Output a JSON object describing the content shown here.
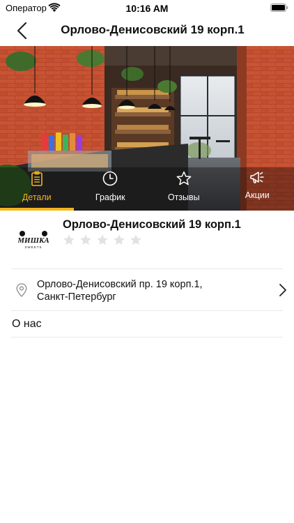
{
  "status_bar": {
    "carrier": "Оператор",
    "time": "10:16 AM"
  },
  "nav": {
    "title": "Орлово-Денисовский 19 корп.1",
    "back_icon": "chevron-left-icon"
  },
  "tabs": [
    {
      "label": "Детали",
      "icon": "clipboard-icon",
      "active": true
    },
    {
      "label": "График",
      "icon": "clock-icon",
      "active": false
    },
    {
      "label": "Отзывы",
      "icon": "star-outline-icon",
      "active": false
    },
    {
      "label": "Акции",
      "icon": "megaphone-icon",
      "active": false
    }
  ],
  "place": {
    "logo_text": "МИШКА",
    "logo_subtext": "SWEETS",
    "title": "Орлово-Денисовский 19 корп.1",
    "rating": 0,
    "rating_max": 5
  },
  "address": {
    "line1": "Орлово-Денисовский пр. 19 корп.1,",
    "line2": "Санкт-Петербург"
  },
  "about": {
    "label": "О нас"
  },
  "colors": {
    "accent": "#f5b51c",
    "star_empty": "#e2e2e2",
    "text": "#111111"
  }
}
